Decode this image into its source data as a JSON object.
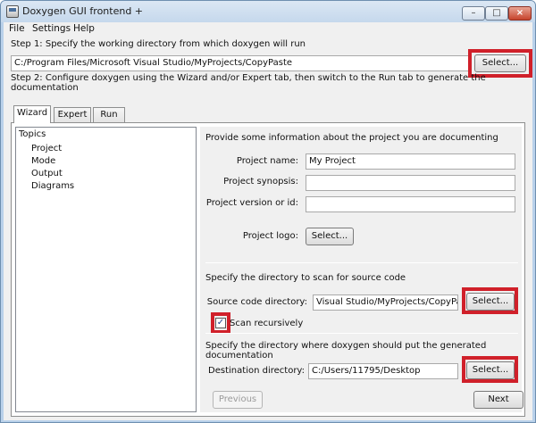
{
  "window": {
    "title": "Doxygen GUI frontend +",
    "controls": {
      "minimize": "–",
      "maximize": "□",
      "close": "×"
    }
  },
  "menu": [
    "File",
    "Settings",
    "Help"
  ],
  "step1": {
    "label": "Step 1: Specify the working directory from which doxygen will run",
    "path": "C:/Program Files/Microsoft Visual Studio/MyProjects/CopyPaste",
    "select_label": "Select..."
  },
  "step2": {
    "label": "Step 2: Configure doxygen using the Wizard and/or Expert tab, then switch to the Run tab to generate the documentation"
  },
  "tabs": [
    "Wizard",
    "Expert",
    "Run"
  ],
  "topics": {
    "header": "Topics",
    "items": [
      "Project",
      "Mode",
      "Output",
      "Diagrams"
    ]
  },
  "project": {
    "intro": "Provide some information about the project you are documenting",
    "name_label": "Project name:",
    "name_value": "My Project",
    "synopsis_label": "Project synopsis:",
    "synopsis_value": "",
    "version_label": "Project version or id:",
    "version_value": "",
    "logo_label": "Project logo:",
    "logo_button": "Select..."
  },
  "source": {
    "heading": "Specify the directory to scan for source code",
    "label": "Source code directory:",
    "value": "Visual Studio/MyProjects/CopyPaste",
    "select_label": "Select...",
    "recursive_label": "Scan recursively",
    "recursive_checked": true,
    "check_mark": "✓"
  },
  "destination": {
    "heading": "Specify the directory where doxygen should put the generated documentation",
    "label": "Destination directory:",
    "value": "C:/Users/11795/Desktop",
    "select_label": "Select..."
  },
  "nav": {
    "previous": "Previous",
    "next": "Next"
  },
  "colors": {
    "highlight": "#d0202a"
  }
}
